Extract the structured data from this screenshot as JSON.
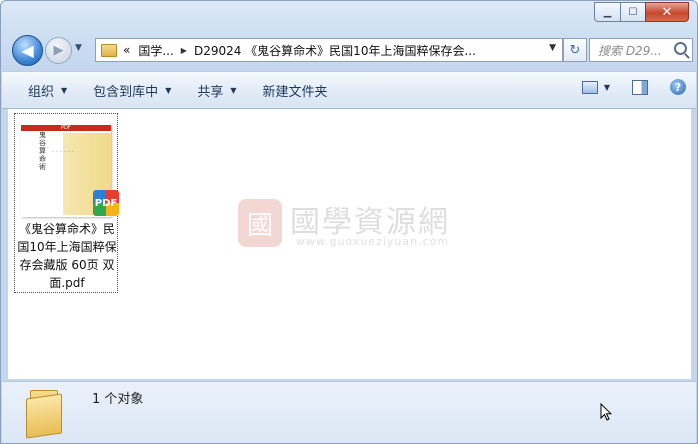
{
  "window": {
    "caption": {
      "minimize": "▁",
      "maximize": "☐",
      "close": "✕"
    }
  },
  "nav": {
    "back_glyph": "◀",
    "forward_glyph": "▶",
    "address": {
      "overflow": "«",
      "crumbs": [
        "国学...",
        "D29024 《鬼谷算命术》民国10年上海国粹保存会..."
      ]
    },
    "refresh_glyph": "↻",
    "search": {
      "placeholder": "搜索 D29..."
    }
  },
  "toolbar": {
    "items": [
      {
        "label": "组织",
        "dropdown": true
      },
      {
        "label": "包含到库中",
        "dropdown": true
      },
      {
        "label": "共享",
        "dropdown": true
      },
      {
        "label": "新建文件夹",
        "dropdown": false
      }
    ],
    "help": "?"
  },
  "files": [
    {
      "name": "《鬼谷算命术》民国10年上海国粹保存会藏版 60页 双面.pdf",
      "thumbnail": {
        "title_vertical": "鬼谷算命術",
        "badge": "PDF",
        "top_label": "PDF"
      }
    }
  ],
  "watermark": {
    "seal": "國",
    "title": "國學資源網",
    "url": "www.guoxueziyuan.com"
  },
  "status": {
    "count_text": "1 个对象"
  }
}
